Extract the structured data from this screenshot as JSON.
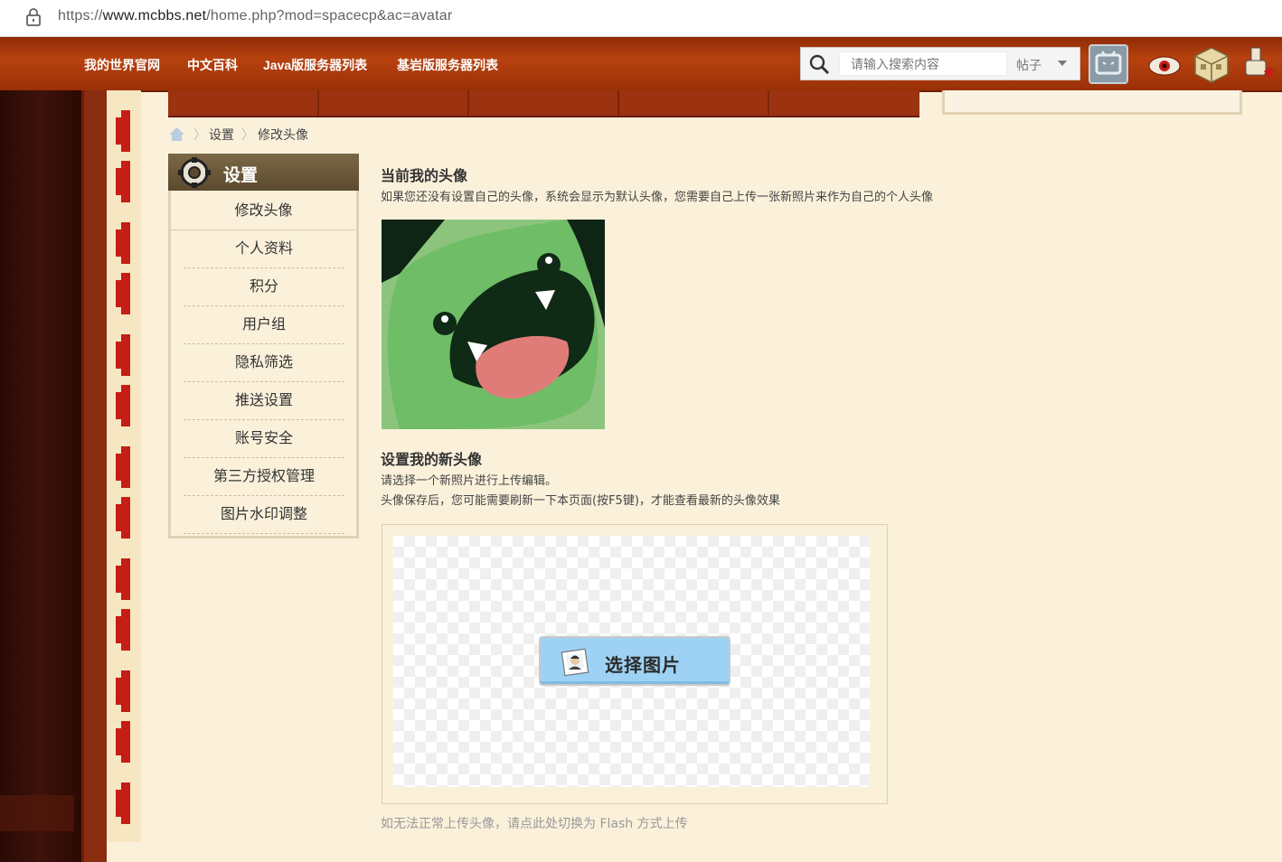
{
  "browser": {
    "url_prefix": "https://",
    "url_host": "www.mcbbs.net",
    "url_path": "/home.php?mod=spacecp&ac=avatar"
  },
  "topnav": {
    "links": [
      "我的世界官网",
      "中文百科",
      "Java版服务器列表",
      "基岩版服务器列表"
    ],
    "search_placeholder": "请输入搜索内容",
    "search_type": "帖子",
    "icons": [
      "bilibili-icon",
      "eye-icon",
      "block-icon",
      "alchemy-icon"
    ]
  },
  "breadcrumb": {
    "items": [
      "设置",
      "修改头像"
    ]
  },
  "sidebar": {
    "title": "设置",
    "items": [
      "修改头像",
      "个人资料",
      "积分",
      "用户组",
      "隐私筛选",
      "推送设置",
      "账号安全",
      "第三方授权管理",
      "图片水印调整"
    ]
  },
  "main": {
    "current_title": "当前我的头像",
    "current_desc": "如果您还没有设置自己的头像，系统会显示为默认头像，您需要自己上传一张新照片来作为自己的个人头像",
    "new_title": "设置我的新头像",
    "new_desc1": "请选择一个新照片进行上传编辑。",
    "new_desc2": "头像保存后，您可能需要刷新一下本页面(按F5键)，才能查看最新的头像效果",
    "pick_button": "选择图片",
    "flash_link": "如无法正常上传头像，请点此处切换为 Flash 方式上传"
  },
  "colors": {
    "nav_bg": "#a8380c",
    "page_bg": "#fbf1db",
    "sidebar_head": "#6b5a3b",
    "button_bg": "#9ed2f4",
    "chain_red": "#c41e16"
  }
}
